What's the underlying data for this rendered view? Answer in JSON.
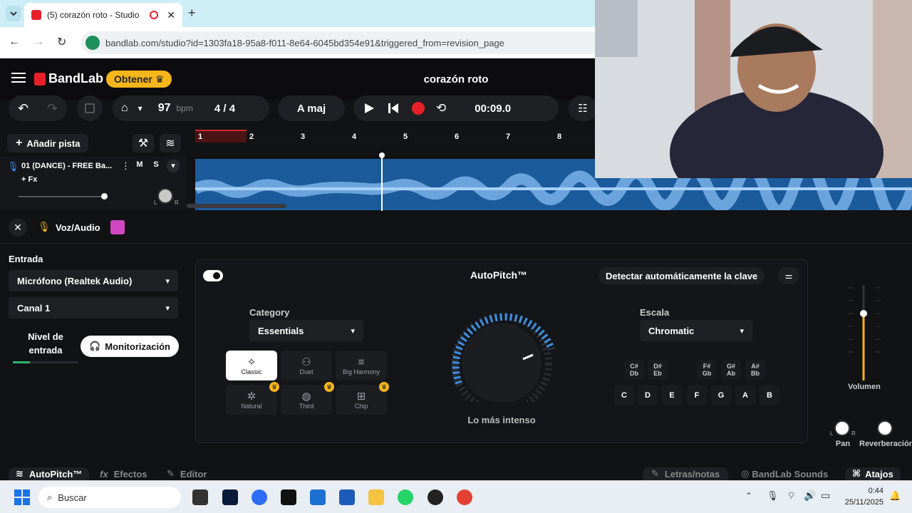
{
  "browser": {
    "tab_title": "(5) corazón roto - Studio",
    "url": "bandlab.com/studio?id=1303fa18-95a8-f011-8e64-6045bd354e91&triggered_from=revision_page"
  },
  "app": {
    "brand": "BandLab",
    "get_button": "Obtener",
    "project_title": "corazón roto"
  },
  "transport": {
    "bpm": "97",
    "bpm_unit": "bpm",
    "time_sig": "4 / 4",
    "key": "A maj",
    "time": "00:09.0"
  },
  "tracks": {
    "add_track": "Añadir pista",
    "ruler": [
      "1",
      "2",
      "3",
      "4",
      "5",
      "6",
      "7",
      "8"
    ],
    "items": [
      {
        "name": "01 (DANCE) - FREE Ba...",
        "mute": "M",
        "solo": "S",
        "fx": "+ Fx",
        "pan_l": "L",
        "pan_r": "R"
      }
    ]
  },
  "inspector": {
    "track_type": "Voz/Audio",
    "input_label": "Entrada",
    "input_device": "Micrófono (Realtek Audio)",
    "channel": "Canal 1",
    "input_level": "Nivel de entrada",
    "monitoring": "Monitorización"
  },
  "autopitch": {
    "title": "AutoPitch™",
    "detect_key": "Detectar automáticamente la clave",
    "category_label": "Category",
    "category_value": "Essentials",
    "effects": [
      {
        "label": "Classic",
        "selected": true,
        "premium": false
      },
      {
        "label": "Duet",
        "selected": false,
        "premium": false
      },
      {
        "label": "Big Harmony",
        "selected": false,
        "premium": false
      },
      {
        "label": "Natural",
        "selected": false,
        "premium": true
      },
      {
        "label": "Third",
        "selected": false,
        "premium": true
      },
      {
        "label": "Chip",
        "selected": false,
        "premium": true
      }
    ],
    "knob_label": "Lo más intenso",
    "scale_label": "Escala",
    "scale_value": "Chromatic",
    "sharp_keys": [
      "C#\nDb",
      "D#\nEb",
      "F#\nGb",
      "G#\nAb",
      "A#\nBb"
    ],
    "natural_keys": [
      "C",
      "D",
      "E",
      "F",
      "G",
      "A",
      "B"
    ]
  },
  "mixer": {
    "volume": "Volumen",
    "pan": "Pan",
    "reverb": "Reverberación",
    "pan_l": "L",
    "pan_r": "R"
  },
  "bottom_tabs": {
    "left": [
      "AutoPitch™",
      "Efectos",
      "Editor"
    ],
    "right": [
      "Letras/notas",
      "BandLab Sounds",
      "Atajos"
    ]
  },
  "taskbar": {
    "search": "Buscar",
    "time": "0:44",
    "date": "25/11/2025"
  },
  "colors": {
    "brand": "#f5b51b",
    "record": "#e8202a",
    "waveform": "#1b5b9c",
    "accent": "#f5b51b"
  }
}
